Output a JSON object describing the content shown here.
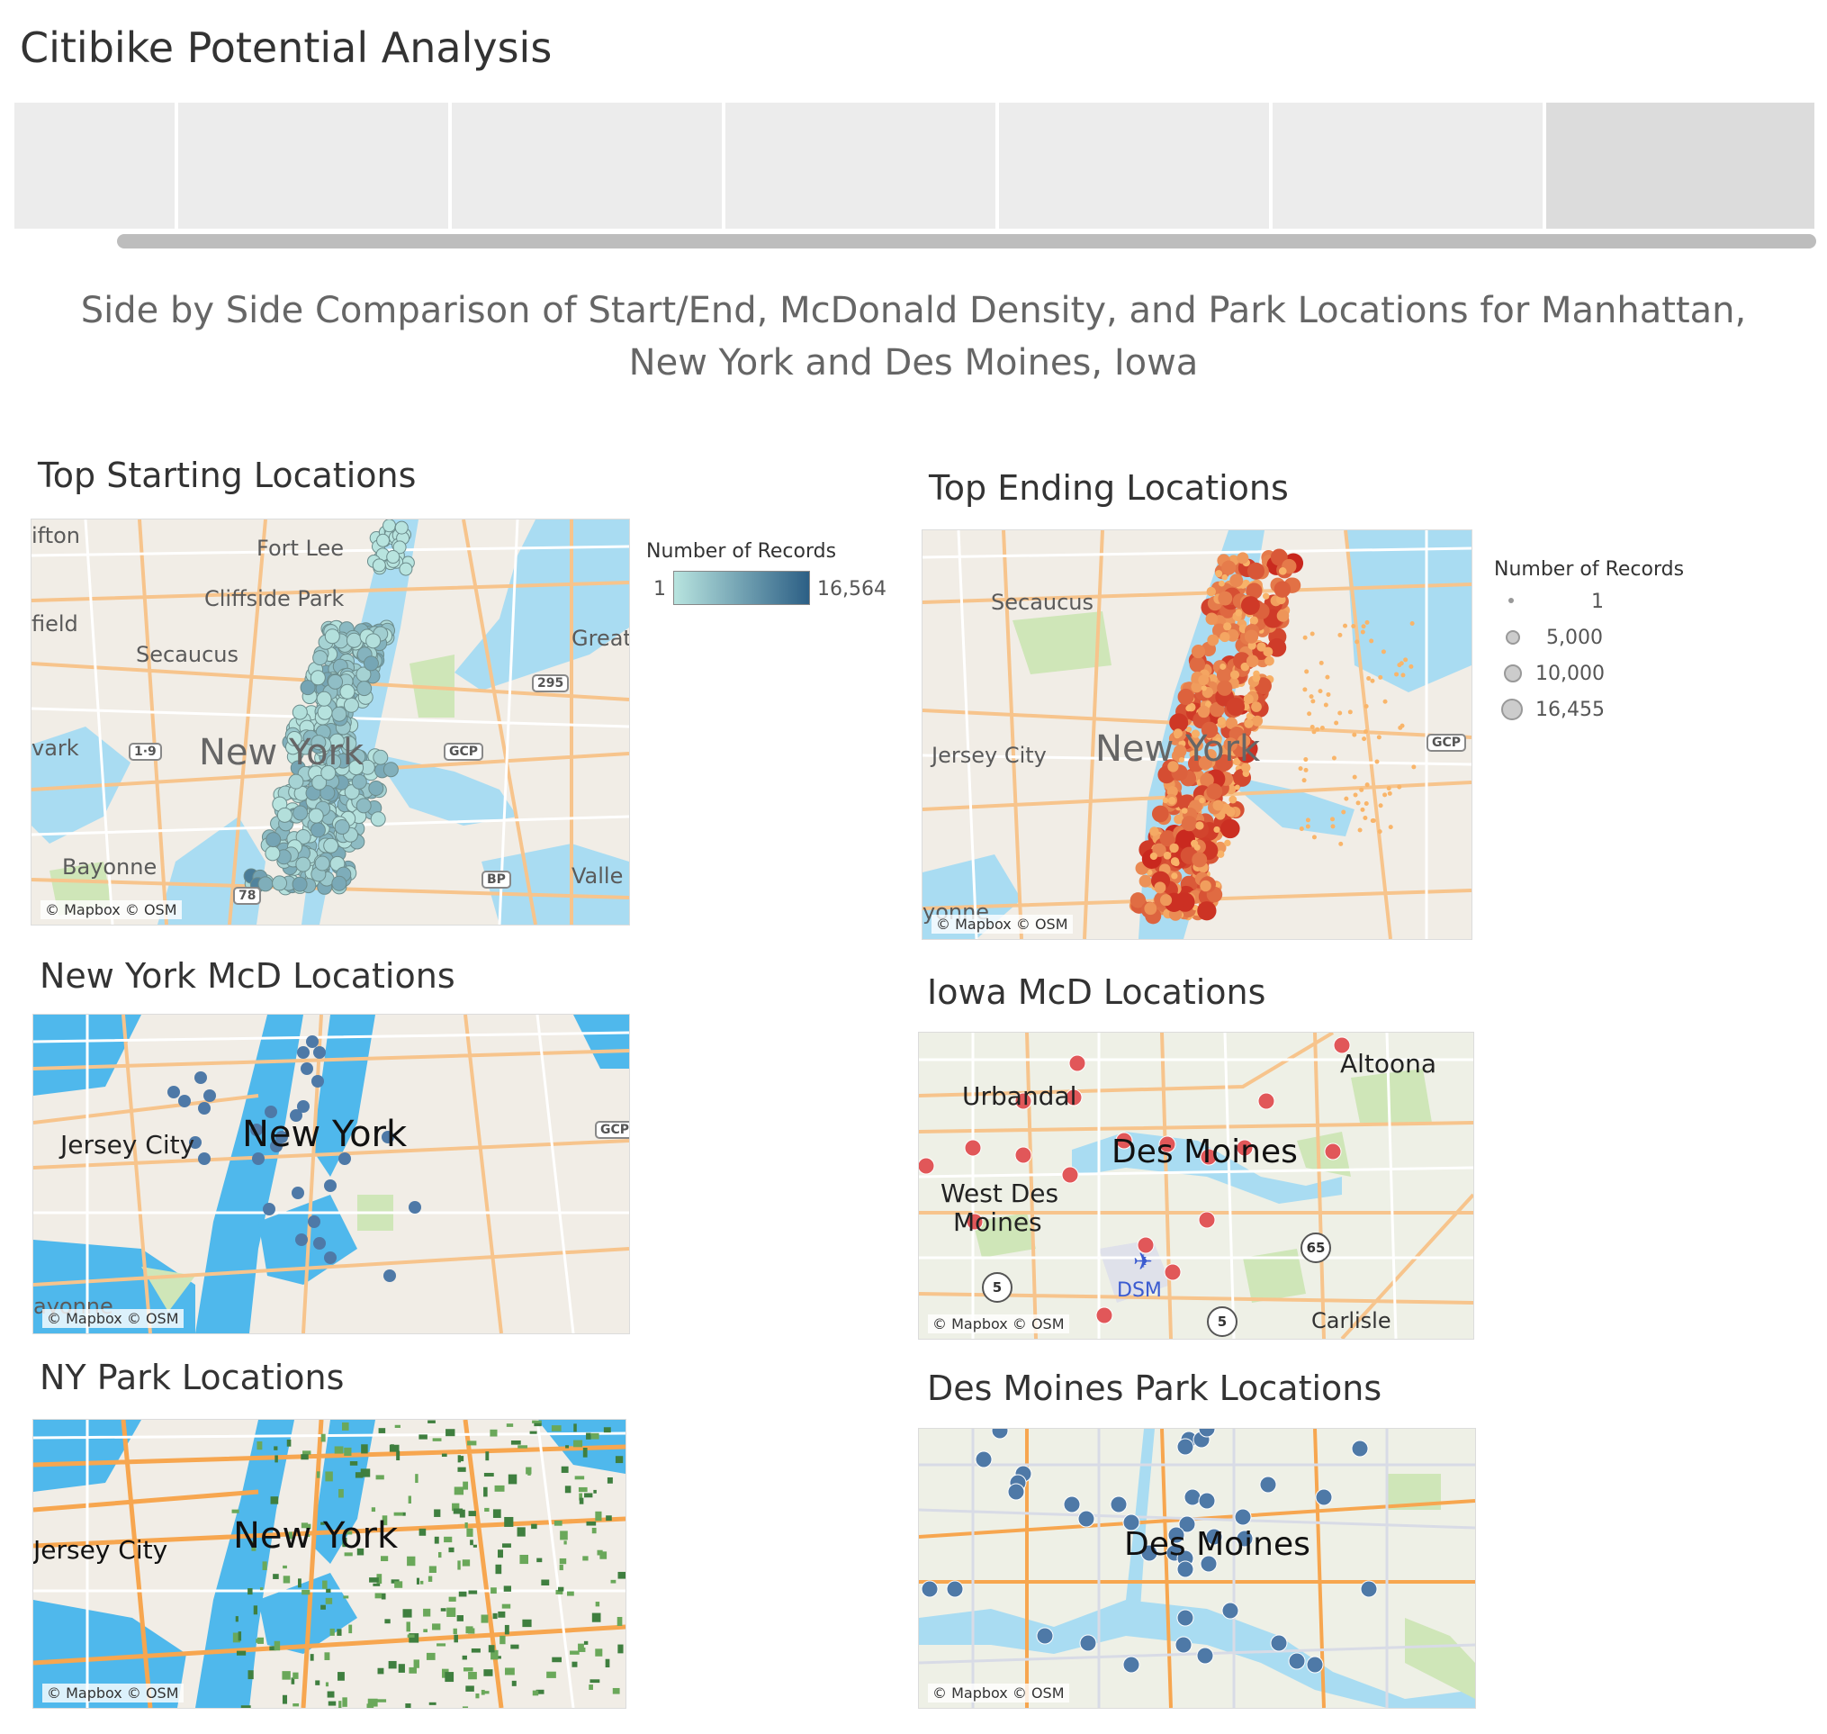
{
  "dashboard": {
    "title": "Citibike Potential Analysis",
    "subtitle": "Side by Side Comparison of Start/End, McDonald Density, and Park Locations for Manhattan, New York and Des Moines, Iowa",
    "tabs": [
      "",
      "",
      "",
      "",
      "",
      "",
      ""
    ],
    "selected_tab_index": 6
  },
  "colors": {
    "water": "#a9dcf2",
    "land": "#f1ede6",
    "park": "#cfe6b8",
    "road": "#f7c48c",
    "start_gradient": [
      "#b8e4df",
      "#2c5f85"
    ],
    "end_fill": "#f47c2a",
    "ny_mcd_dot": "#4e79a7",
    "iowa_mcd_dot": "#e15759",
    "park_dot": "#4e79a7"
  },
  "maps": {
    "top_start": {
      "title": "Top Starting Locations",
      "attribution": "© Mapbox © OSM",
      "place_labels": [
        "ifton",
        "Fort Lee",
        "Cliffside Park",
        "field",
        "Secaucus",
        "Great",
        "vark",
        "New York",
        "Bayonne",
        "Valle"
      ],
      "highway_shields": [
        "295",
        "1·9",
        "GCP",
        "BP",
        "78"
      ],
      "legend": {
        "title": "Number of Records",
        "min": "1",
        "max": "16,564",
        "type": "color-gradient"
      }
    },
    "top_end": {
      "title": "Top Ending Locations",
      "attribution": "© Mapbox © OSM",
      "place_labels": [
        "Secaucus",
        "Jersey City",
        "New York",
        "yonne"
      ],
      "highway_shields": [
        "GCP"
      ],
      "legend": {
        "title": "Number of Records",
        "type": "size",
        "values": [
          "1",
          "5,000",
          "10,000",
          "16,455"
        ]
      }
    },
    "ny_mcd": {
      "title": "New York McD Locations",
      "attribution": "© Mapbox © OSM",
      "place_labels": [
        "Jersey City",
        "New York",
        "ayonne"
      ],
      "highway_shields": [
        "GCP"
      ]
    },
    "iowa_mcd": {
      "title": "Iowa McD Locations",
      "attribution": "© Mapbox © OSM",
      "place_labels": [
        "Altoona",
        "Urbandal",
        "Des Moines",
        "West Des",
        "Moines",
        "DSM",
        "Carlisle"
      ],
      "highway_shields": [
        "65",
        "5",
        "5"
      ]
    },
    "ny_park": {
      "title": "NY Park Locations",
      "attribution": "© Mapbox © OSM",
      "place_labels": [
        "Jersey City",
        "New York"
      ]
    },
    "dm_park": {
      "title": "Des Moines Park Locations",
      "attribution": "© Mapbox © OSM",
      "place_labels": [
        "Des Moines"
      ]
    }
  }
}
